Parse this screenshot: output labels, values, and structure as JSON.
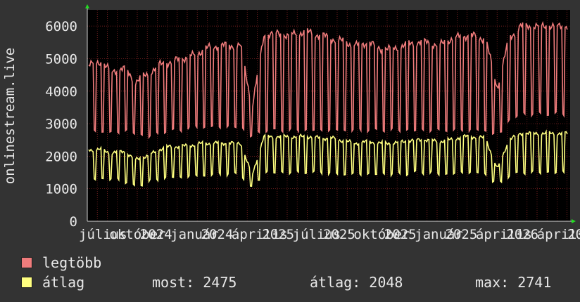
{
  "chart_data": {
    "type": "line",
    "ylabel": "onlinestream.live",
    "ylim": [
      0,
      6500
    ],
    "yticks": [
      0,
      1000,
      2000,
      3000,
      4000,
      5000,
      6000
    ],
    "grid": true,
    "x_tick_labels": [
      "július",
      "október",
      "2024",
      "január",
      "2024",
      "április",
      "2025",
      "július",
      "2025",
      "október",
      "2025",
      "január",
      "2025",
      "április",
      "2026",
      "április",
      "20"
    ],
    "series": [
      {
        "name": "legtöbb",
        "color": "#f07c7c",
        "weekday_level": [
          4800,
          4900,
          4600,
          4700,
          4300,
          4500,
          4800,
          4900,
          5000,
          5100,
          5300,
          5400,
          5400,
          5400,
          3500,
          5700,
          5800,
          5700,
          5800,
          5800,
          5700,
          5600,
          5500,
          5400,
          5500,
          5300,
          5300,
          5400,
          5500,
          5500,
          5400,
          5600,
          5700,
          5700,
          5600,
          4100,
          5600,
          6000,
          6000,
          6000,
          6000,
          6000
        ],
        "weekend_level": [
          2700,
          2800,
          2700,
          2800,
          2700,
          2600,
          2700,
          2800,
          2800,
          2900,
          2900,
          2900,
          2900,
          2900,
          2600,
          2800,
          2800,
          2800,
          2800,
          2800,
          2800,
          2800,
          2800,
          2800,
          2800,
          2800,
          2800,
          2800,
          2800,
          2800,
          2800,
          2800,
          2800,
          2800,
          2800,
          2600,
          3100,
          3300,
          3300,
          3300,
          3300,
          3300
        ]
      },
      {
        "name": "átlag",
        "color": "#ffff80",
        "weekday_level": [
          2200,
          2200,
          2100,
          2150,
          1900,
          2000,
          2200,
          2300,
          2300,
          2350,
          2400,
          2400,
          2400,
          2400,
          1400,
          2600,
          2600,
          2600,
          2600,
          2600,
          2550,
          2550,
          2450,
          2400,
          2450,
          2400,
          2400,
          2450,
          2500,
          2500,
          2450,
          2500,
          2600,
          2600,
          2550,
          1600,
          2500,
          2700,
          2700,
          2700,
          2700,
          2700
        ],
        "weekend_level": [
          1300,
          1300,
          1300,
          1250,
          1050,
          1200,
          1300,
          1350,
          1350,
          1400,
          1400,
          1450,
          1450,
          1450,
          1000,
          1500,
          1500,
          1500,
          1500,
          1500,
          1500,
          1450,
          1450,
          1450,
          1450,
          1450,
          1450,
          1450,
          1500,
          1500,
          1450,
          1450,
          1500,
          1500,
          1450,
          1100,
          1400,
          1500,
          1500,
          1500,
          1500,
          1500
        ]
      }
    ]
  },
  "legend": {
    "max_label": "legtöbb",
    "avg_label": "átlag",
    "colors": {
      "max": "#f07c7c",
      "avg": "#ffff80"
    }
  },
  "stats": {
    "now": "most: 2475",
    "avg": "átlag: 2048",
    "max": "max: 2741"
  }
}
